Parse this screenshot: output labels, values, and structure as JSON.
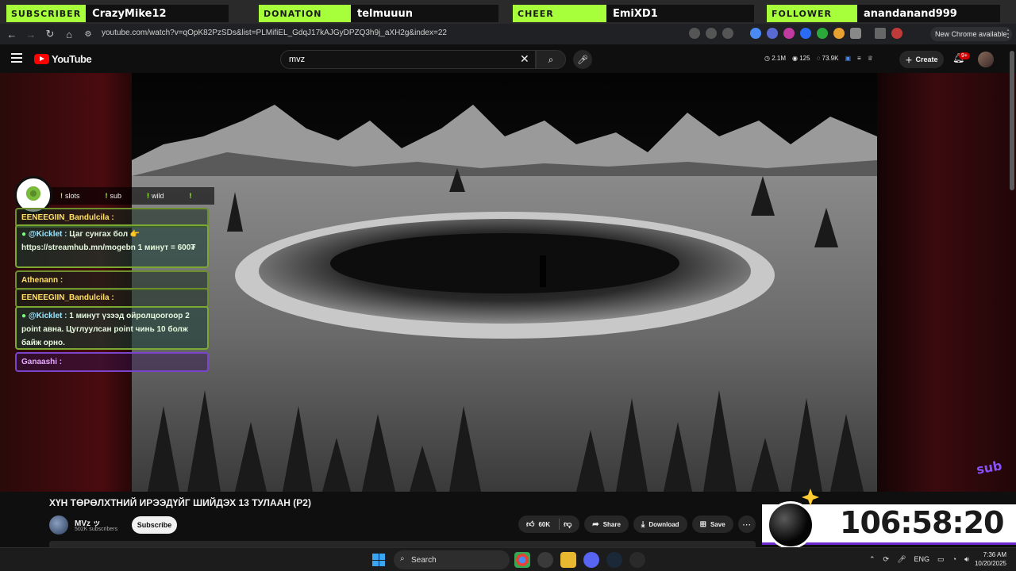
{
  "overlay": {
    "segments": [
      {
        "label": "SUBSCRIBER",
        "value": "CrazyMike12"
      },
      {
        "label": "DONATION",
        "value": "telmuuun"
      },
      {
        "label": "CHEER",
        "value": "EmiXD1"
      },
      {
        "label": "FOLLOWER",
        "value": "anandanand999"
      }
    ]
  },
  "browser": {
    "url": "youtube.com/watch?v=qOpK82PzSDs&list=PLMifiEL_GdqJ17kAJGyDPZQ3h9j_aXH2g&index=22",
    "new_chrome": "New Chrome available"
  },
  "header": {
    "logo_text": "YouTube",
    "search_value": "mvz",
    "stats": [
      "2.1M",
      "125",
      "73.9K"
    ],
    "create_label": "Create",
    "notification_count": "9+"
  },
  "chat": {
    "commands": [
      "slots",
      "sub",
      "wild",
      "!"
    ],
    "messages": [
      {
        "user": "EENEEGIIN_Bandulcila :",
        "text": "",
        "style": "plain"
      },
      {
        "user": "@Kicklet :",
        "text": "Цаг сунгах бол 👉 https://streamhub.mn/mogebn 1 минут = 600₮",
        "style": "normal"
      },
      {
        "user": "Athenann :",
        "text": "",
        "style": "plain"
      },
      {
        "user": "EENEEGIIN_Bandulcila :",
        "text": "",
        "style": "plain"
      },
      {
        "user": "@Kicklet :",
        "text": "1 минут үзээд ойролцоогоор 2 point авна. Цуглуулсан point чинь 10 болж байж орно.",
        "style": "normal"
      },
      {
        "user": "Ganaashi :",
        "text": "",
        "style": "purple"
      }
    ]
  },
  "watermark": "sub",
  "video": {
    "title": "ХҮН ТӨРӨЛХТНИЙ ИРЭЭДҮЙГ ШИЙДЭХ 13 ТУЛААН (P2)",
    "channel": "MVz ッ",
    "subscribers": "502K subscribers",
    "subscribe_label": "Subscribe",
    "like_count": "60K",
    "share_label": "Share",
    "download_label": "Download",
    "save_label": "Save"
  },
  "timer": "106:58:20",
  "taskbar": {
    "search_label": "Search",
    "language": "ENG",
    "time": "7:36 AM",
    "date": "10/20/2025"
  }
}
